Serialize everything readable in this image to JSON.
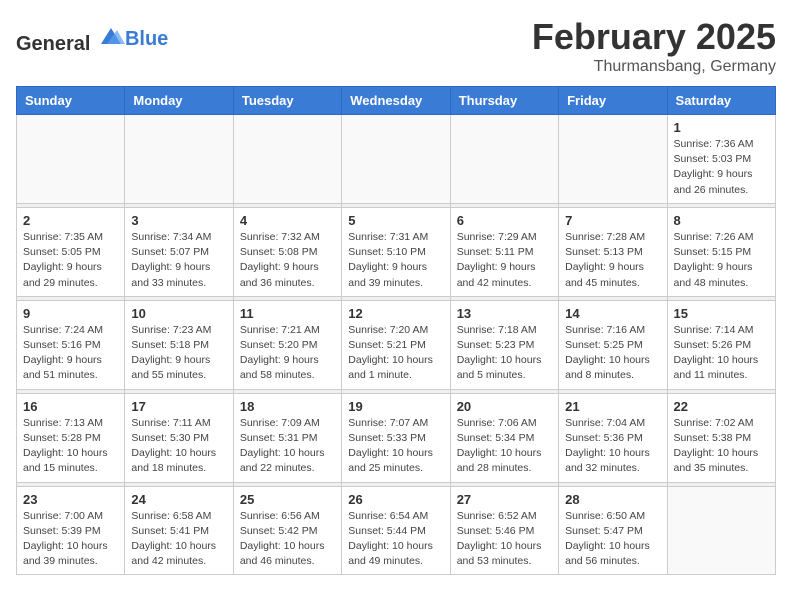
{
  "header": {
    "logo_general": "General",
    "logo_blue": "Blue",
    "month": "February 2025",
    "location": "Thurmansbang, Germany"
  },
  "days_of_week": [
    "Sunday",
    "Monday",
    "Tuesday",
    "Wednesday",
    "Thursday",
    "Friday",
    "Saturday"
  ],
  "weeks": [
    [
      {
        "day": "",
        "info": ""
      },
      {
        "day": "",
        "info": ""
      },
      {
        "day": "",
        "info": ""
      },
      {
        "day": "",
        "info": ""
      },
      {
        "day": "",
        "info": ""
      },
      {
        "day": "",
        "info": ""
      },
      {
        "day": "1",
        "info": "Sunrise: 7:36 AM\nSunset: 5:03 PM\nDaylight: 9 hours and 26 minutes."
      }
    ],
    [
      {
        "day": "2",
        "info": "Sunrise: 7:35 AM\nSunset: 5:05 PM\nDaylight: 9 hours and 29 minutes."
      },
      {
        "day": "3",
        "info": "Sunrise: 7:34 AM\nSunset: 5:07 PM\nDaylight: 9 hours and 33 minutes."
      },
      {
        "day": "4",
        "info": "Sunrise: 7:32 AM\nSunset: 5:08 PM\nDaylight: 9 hours and 36 minutes."
      },
      {
        "day": "5",
        "info": "Sunrise: 7:31 AM\nSunset: 5:10 PM\nDaylight: 9 hours and 39 minutes."
      },
      {
        "day": "6",
        "info": "Sunrise: 7:29 AM\nSunset: 5:11 PM\nDaylight: 9 hours and 42 minutes."
      },
      {
        "day": "7",
        "info": "Sunrise: 7:28 AM\nSunset: 5:13 PM\nDaylight: 9 hours and 45 minutes."
      },
      {
        "day": "8",
        "info": "Sunrise: 7:26 AM\nSunset: 5:15 PM\nDaylight: 9 hours and 48 minutes."
      }
    ],
    [
      {
        "day": "9",
        "info": "Sunrise: 7:24 AM\nSunset: 5:16 PM\nDaylight: 9 hours and 51 minutes."
      },
      {
        "day": "10",
        "info": "Sunrise: 7:23 AM\nSunset: 5:18 PM\nDaylight: 9 hours and 55 minutes."
      },
      {
        "day": "11",
        "info": "Sunrise: 7:21 AM\nSunset: 5:20 PM\nDaylight: 9 hours and 58 minutes."
      },
      {
        "day": "12",
        "info": "Sunrise: 7:20 AM\nSunset: 5:21 PM\nDaylight: 10 hours and 1 minute."
      },
      {
        "day": "13",
        "info": "Sunrise: 7:18 AM\nSunset: 5:23 PM\nDaylight: 10 hours and 5 minutes."
      },
      {
        "day": "14",
        "info": "Sunrise: 7:16 AM\nSunset: 5:25 PM\nDaylight: 10 hours and 8 minutes."
      },
      {
        "day": "15",
        "info": "Sunrise: 7:14 AM\nSunset: 5:26 PM\nDaylight: 10 hours and 11 minutes."
      }
    ],
    [
      {
        "day": "16",
        "info": "Sunrise: 7:13 AM\nSunset: 5:28 PM\nDaylight: 10 hours and 15 minutes."
      },
      {
        "day": "17",
        "info": "Sunrise: 7:11 AM\nSunset: 5:30 PM\nDaylight: 10 hours and 18 minutes."
      },
      {
        "day": "18",
        "info": "Sunrise: 7:09 AM\nSunset: 5:31 PM\nDaylight: 10 hours and 22 minutes."
      },
      {
        "day": "19",
        "info": "Sunrise: 7:07 AM\nSunset: 5:33 PM\nDaylight: 10 hours and 25 minutes."
      },
      {
        "day": "20",
        "info": "Sunrise: 7:06 AM\nSunset: 5:34 PM\nDaylight: 10 hours and 28 minutes."
      },
      {
        "day": "21",
        "info": "Sunrise: 7:04 AM\nSunset: 5:36 PM\nDaylight: 10 hours and 32 minutes."
      },
      {
        "day": "22",
        "info": "Sunrise: 7:02 AM\nSunset: 5:38 PM\nDaylight: 10 hours and 35 minutes."
      }
    ],
    [
      {
        "day": "23",
        "info": "Sunrise: 7:00 AM\nSunset: 5:39 PM\nDaylight: 10 hours and 39 minutes."
      },
      {
        "day": "24",
        "info": "Sunrise: 6:58 AM\nSunset: 5:41 PM\nDaylight: 10 hours and 42 minutes."
      },
      {
        "day": "25",
        "info": "Sunrise: 6:56 AM\nSunset: 5:42 PM\nDaylight: 10 hours and 46 minutes."
      },
      {
        "day": "26",
        "info": "Sunrise: 6:54 AM\nSunset: 5:44 PM\nDaylight: 10 hours and 49 minutes."
      },
      {
        "day": "27",
        "info": "Sunrise: 6:52 AM\nSunset: 5:46 PM\nDaylight: 10 hours and 53 minutes."
      },
      {
        "day": "28",
        "info": "Sunrise: 6:50 AM\nSunset: 5:47 PM\nDaylight: 10 hours and 56 minutes."
      },
      {
        "day": "",
        "info": ""
      }
    ]
  ]
}
